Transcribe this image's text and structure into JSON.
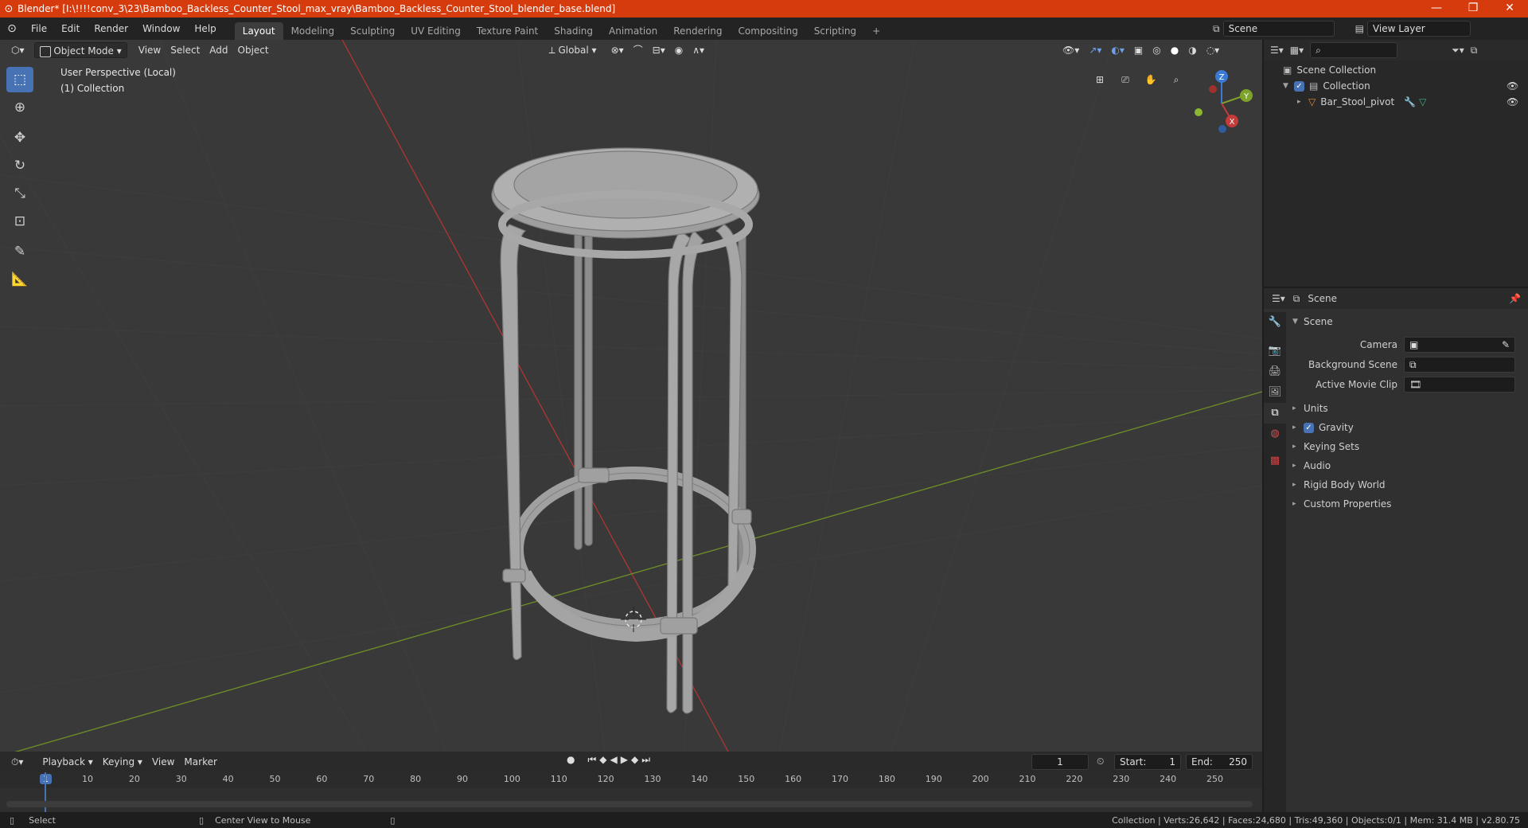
{
  "titlebar": {
    "title": "Blender* [I:\\!!!!conv_3\\23\\Bamboo_Backless_Counter_Stool_max_vray\\Bamboo_Backless_Counter_Stool_blender_base.blend]",
    "minimize": "—",
    "restore": "❐",
    "close": "✕"
  },
  "menu": [
    "File",
    "Edit",
    "Render",
    "Window",
    "Help"
  ],
  "workspaces": [
    "Layout",
    "Modeling",
    "Sculpting",
    "UV Editing",
    "Texture Paint",
    "Shading",
    "Animation",
    "Rendering",
    "Compositing",
    "Scripting"
  ],
  "workspace_add": "+",
  "scene_field": "Scene",
  "view_layer_field": "View Layer",
  "viewport_header": {
    "mode": "Object Mode",
    "menus": [
      "View",
      "Select",
      "Add",
      "Object"
    ],
    "transform_orientation": "Global"
  },
  "viewport_overlay": {
    "perspective": "User Perspective (Local)",
    "collection": "(1) Collection"
  },
  "gizmo": {
    "x": "X",
    "y": "Y",
    "z": "Z"
  },
  "outliner": {
    "root": "Scene Collection",
    "collection": "Collection",
    "object": "Bar_Stool_pivot"
  },
  "properties": {
    "header": "Scene",
    "panel": "Scene",
    "camera_label": "Camera",
    "background_scene_label": "Background Scene",
    "active_movie_clip_label": "Active Movie Clip",
    "sections": [
      "Units",
      "Gravity",
      "Keying Sets",
      "Audio",
      "Rigid Body World",
      "Custom Properties"
    ]
  },
  "timeline": {
    "menus": [
      "Playback",
      "Keying",
      "View",
      "Marker"
    ],
    "current_frame": "1",
    "start_label": "Start:",
    "start": "1",
    "end_label": "End:",
    "end": "250",
    "ticks": [
      "1",
      "10",
      "20",
      "30",
      "40",
      "50",
      "60",
      "70",
      "80",
      "90",
      "100",
      "110",
      "120",
      "130",
      "140",
      "150",
      "160",
      "170",
      "180",
      "190",
      "200",
      "210",
      "220",
      "230",
      "240",
      "250"
    ]
  },
  "statusbar": {
    "select": "Select",
    "center_view": "Center View to Mouse",
    "stats": "Collection | Verts:26,642 | Faces:24,680 | Tris:49,360 | Objects:0/1 | Mem: 31.4 MB | v2.80.75"
  },
  "colors": {
    "titlebar": "#d63b0e",
    "accent": "#4772b3",
    "x_axis": "#c53a3a",
    "y_axis": "#7ea32a",
    "z_axis": "#3a7ad6"
  }
}
